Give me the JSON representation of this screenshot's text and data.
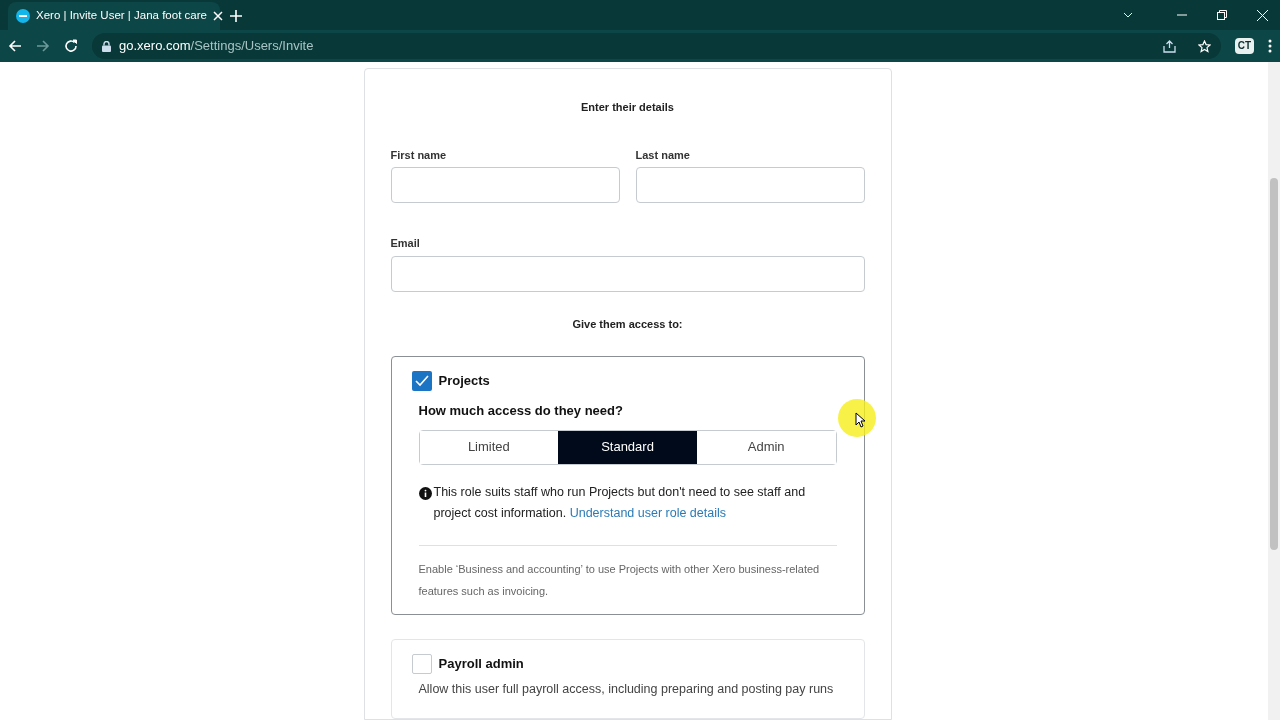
{
  "browser": {
    "tab_title": "Xero | Invite User | Jana foot care",
    "url_host": "go.xero.com",
    "url_path": "/Settings/Users/Invite",
    "profile": "CT"
  },
  "form": {
    "heading": "Enter their details",
    "name_fields": [
      {
        "label": "First name"
      },
      {
        "label": "Last name"
      }
    ],
    "email_field": {
      "label": "Email"
    },
    "access_heading": "Give them access to:",
    "sections": [
      {
        "kind": "expanded",
        "title": "Projects",
        "checked": true,
        "question": "How much access do they need?",
        "options": [
          {
            "label": "Limited",
            "selected": false
          },
          {
            "label": "Standard",
            "selected": true
          },
          {
            "label": "Admin",
            "selected": false
          }
        ],
        "info": "This role suits staff who run Projects but don't need to see staff and project cost information.",
        "link": "Understand user role details",
        "note": "Enable ‘Business and accounting’ to use Projects with other Xero business-related features such as invoicing."
      },
      {
        "kind": "collapsed",
        "title": "Payroll admin",
        "checked": false,
        "description": "Allow this user full payroll access, including preparing and posting pay runs"
      }
    ]
  }
}
